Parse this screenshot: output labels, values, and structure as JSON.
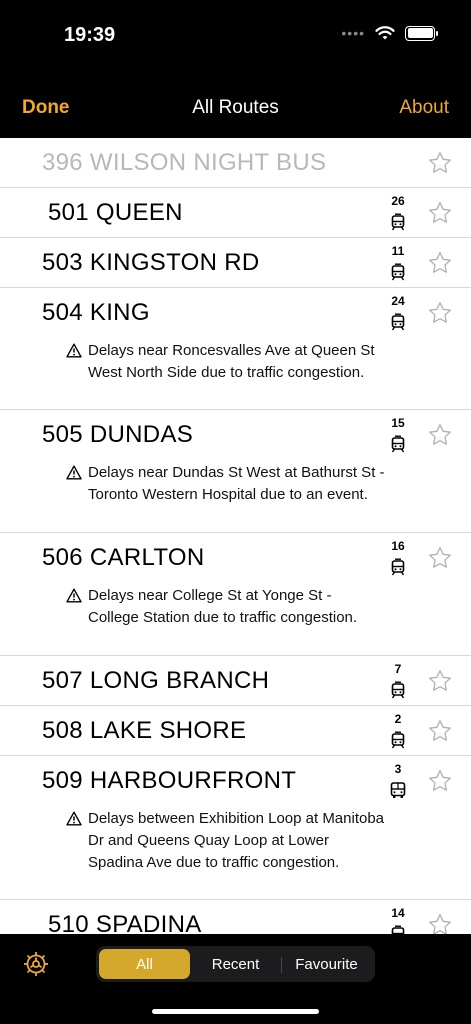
{
  "status": {
    "time": "19:39"
  },
  "nav": {
    "done": "Done",
    "title": "All Routes",
    "about": "About"
  },
  "colors": {
    "accent": "#f0a930",
    "segment_active": "#d4a82a"
  },
  "routes": [
    {
      "name": "396 WILSON NIGHT BUS",
      "count": "",
      "vehicle": "",
      "dim": true,
      "alert": ""
    },
    {
      "name": "501 QUEEN",
      "count": "26",
      "vehicle": "streetcar-icon",
      "alert": ""
    },
    {
      "name": "503 KINGSTON RD",
      "count": "11",
      "vehicle": "streetcar-icon",
      "alert": ""
    },
    {
      "name": "504 KING",
      "count": "24",
      "vehicle": "streetcar-icon",
      "alert": "Delays near Roncesvalles Ave at Queen St West North Side due to traffic congestion."
    },
    {
      "name": "505 DUNDAS",
      "count": "15",
      "vehicle": "streetcar-icon",
      "alert": "Delays near Dundas St West at Bathurst St - Toronto Western Hospital due to an event."
    },
    {
      "name": "506 CARLTON",
      "count": "16",
      "vehicle": "streetcar-icon",
      "alert": "Delays near College St at Yonge St - College Station due to traffic congestion."
    },
    {
      "name": "507 LONG BRANCH",
      "count": "7",
      "vehicle": "streetcar-icon",
      "alert": ""
    },
    {
      "name": "508 LAKE SHORE",
      "count": "2",
      "vehicle": "streetcar-icon",
      "alert": ""
    },
    {
      "name": "509 HARBOURFRONT",
      "count": "3",
      "vehicle": "bus-icon",
      "alert": "Delays between Exhibition Loop at Manitoba Dr and Queens Quay Loop at Lower Spadina Ave due to traffic congestion."
    },
    {
      "name": "510 SPADINA",
      "count": "14",
      "vehicle": "streetcar-icon",
      "alert": ""
    }
  ],
  "tabs": [
    {
      "label": "All",
      "active": true
    },
    {
      "label": "Recent",
      "active": false
    },
    {
      "label": "Favourite",
      "active": false
    }
  ]
}
